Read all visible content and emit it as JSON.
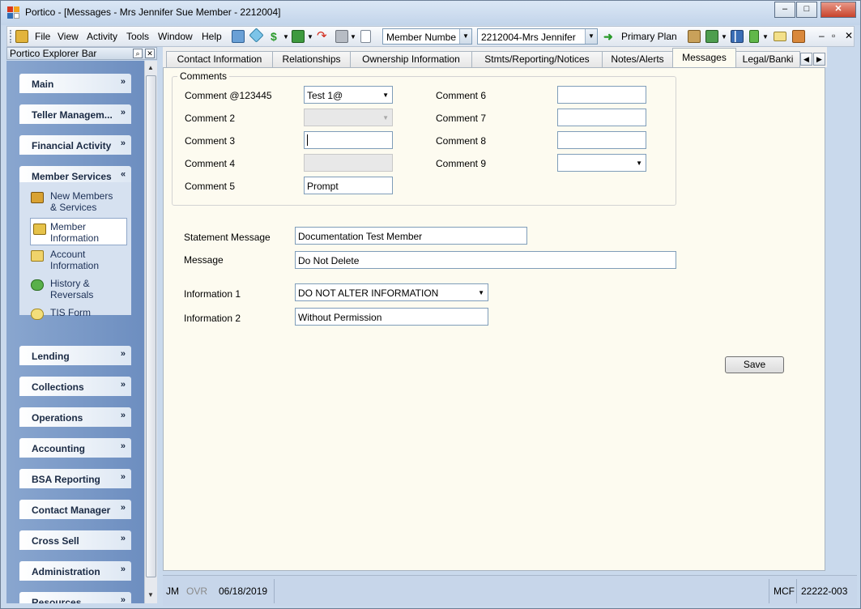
{
  "window": {
    "title": "Portico - [Messages - Mrs Jennifer Sue Member - 2212004]",
    "controls": {
      "minimize": "–",
      "maximize": "□",
      "close": "✕"
    }
  },
  "menubar": {
    "items": [
      "File",
      "View",
      "Activity",
      "Tools",
      "Window",
      "Help"
    ],
    "search_type": "Member Numbe",
    "member_combo": "2212004-Mrs Jennifer",
    "primary_plan": "Primary Plan",
    "mdi_controls": {
      "minimize": "–",
      "restore": "▫",
      "close": "✕"
    }
  },
  "explorer": {
    "title": "Portico Explorer Bar",
    "groups": {
      "main": "Main",
      "teller": "Teller Managem...",
      "financial": "Financial Activity",
      "member_services": "Member Services",
      "lending": "Lending",
      "collections": "Collections",
      "operations": "Operations",
      "accounting": "Accounting",
      "bsa": "BSA Reporting",
      "contact": "Contact Manager",
      "cross_sell": "Cross Sell",
      "administration": "Administration",
      "resources": "Resources"
    },
    "tasks": {
      "new_members_1": "New Members",
      "new_members_2": "& Services",
      "member_info_1": "Member",
      "member_info_2": "Information",
      "account_info_1": "Account",
      "account_info_2": "Information",
      "history_1": "History &",
      "history_2": "Reversals",
      "tis": "TIS Form"
    }
  },
  "tabs": {
    "contact": "Contact Information",
    "relationships": "Relationships",
    "ownership": "Ownership Information",
    "stmts": "Stmts/Reporting/Notices",
    "notes": "Notes/Alerts",
    "messages": "Messages",
    "legal": "Legal/Banki"
  },
  "comments": {
    "group_title": "Comments",
    "c1_label": "Comment @123445",
    "c1_value": "Test 1@",
    "c2_label": "Comment 2",
    "c3_label": "Comment 3",
    "c4_label": "Comment 4",
    "c5_label": "Comment 5",
    "c5_value": "Prompt",
    "c6_label": "Comment 6",
    "c7_label": "Comment 7",
    "c8_label": "Comment 8",
    "c9_label": "Comment 9"
  },
  "form": {
    "statement_label": "Statement Message",
    "statement_value": "Documentation Test Member",
    "message_label": "Message",
    "message_value": "Do Not Delete",
    "info1_label": "Information 1",
    "info1_value": "DO NOT ALTER INFORMATION",
    "info2_label": "Information 2",
    "info2_value": "Without Permission",
    "save": "Save"
  },
  "status": {
    "user": "JM",
    "ovr": "OVR",
    "date": "06/18/2019",
    "mcf": "MCF",
    "code": "22222-003"
  }
}
